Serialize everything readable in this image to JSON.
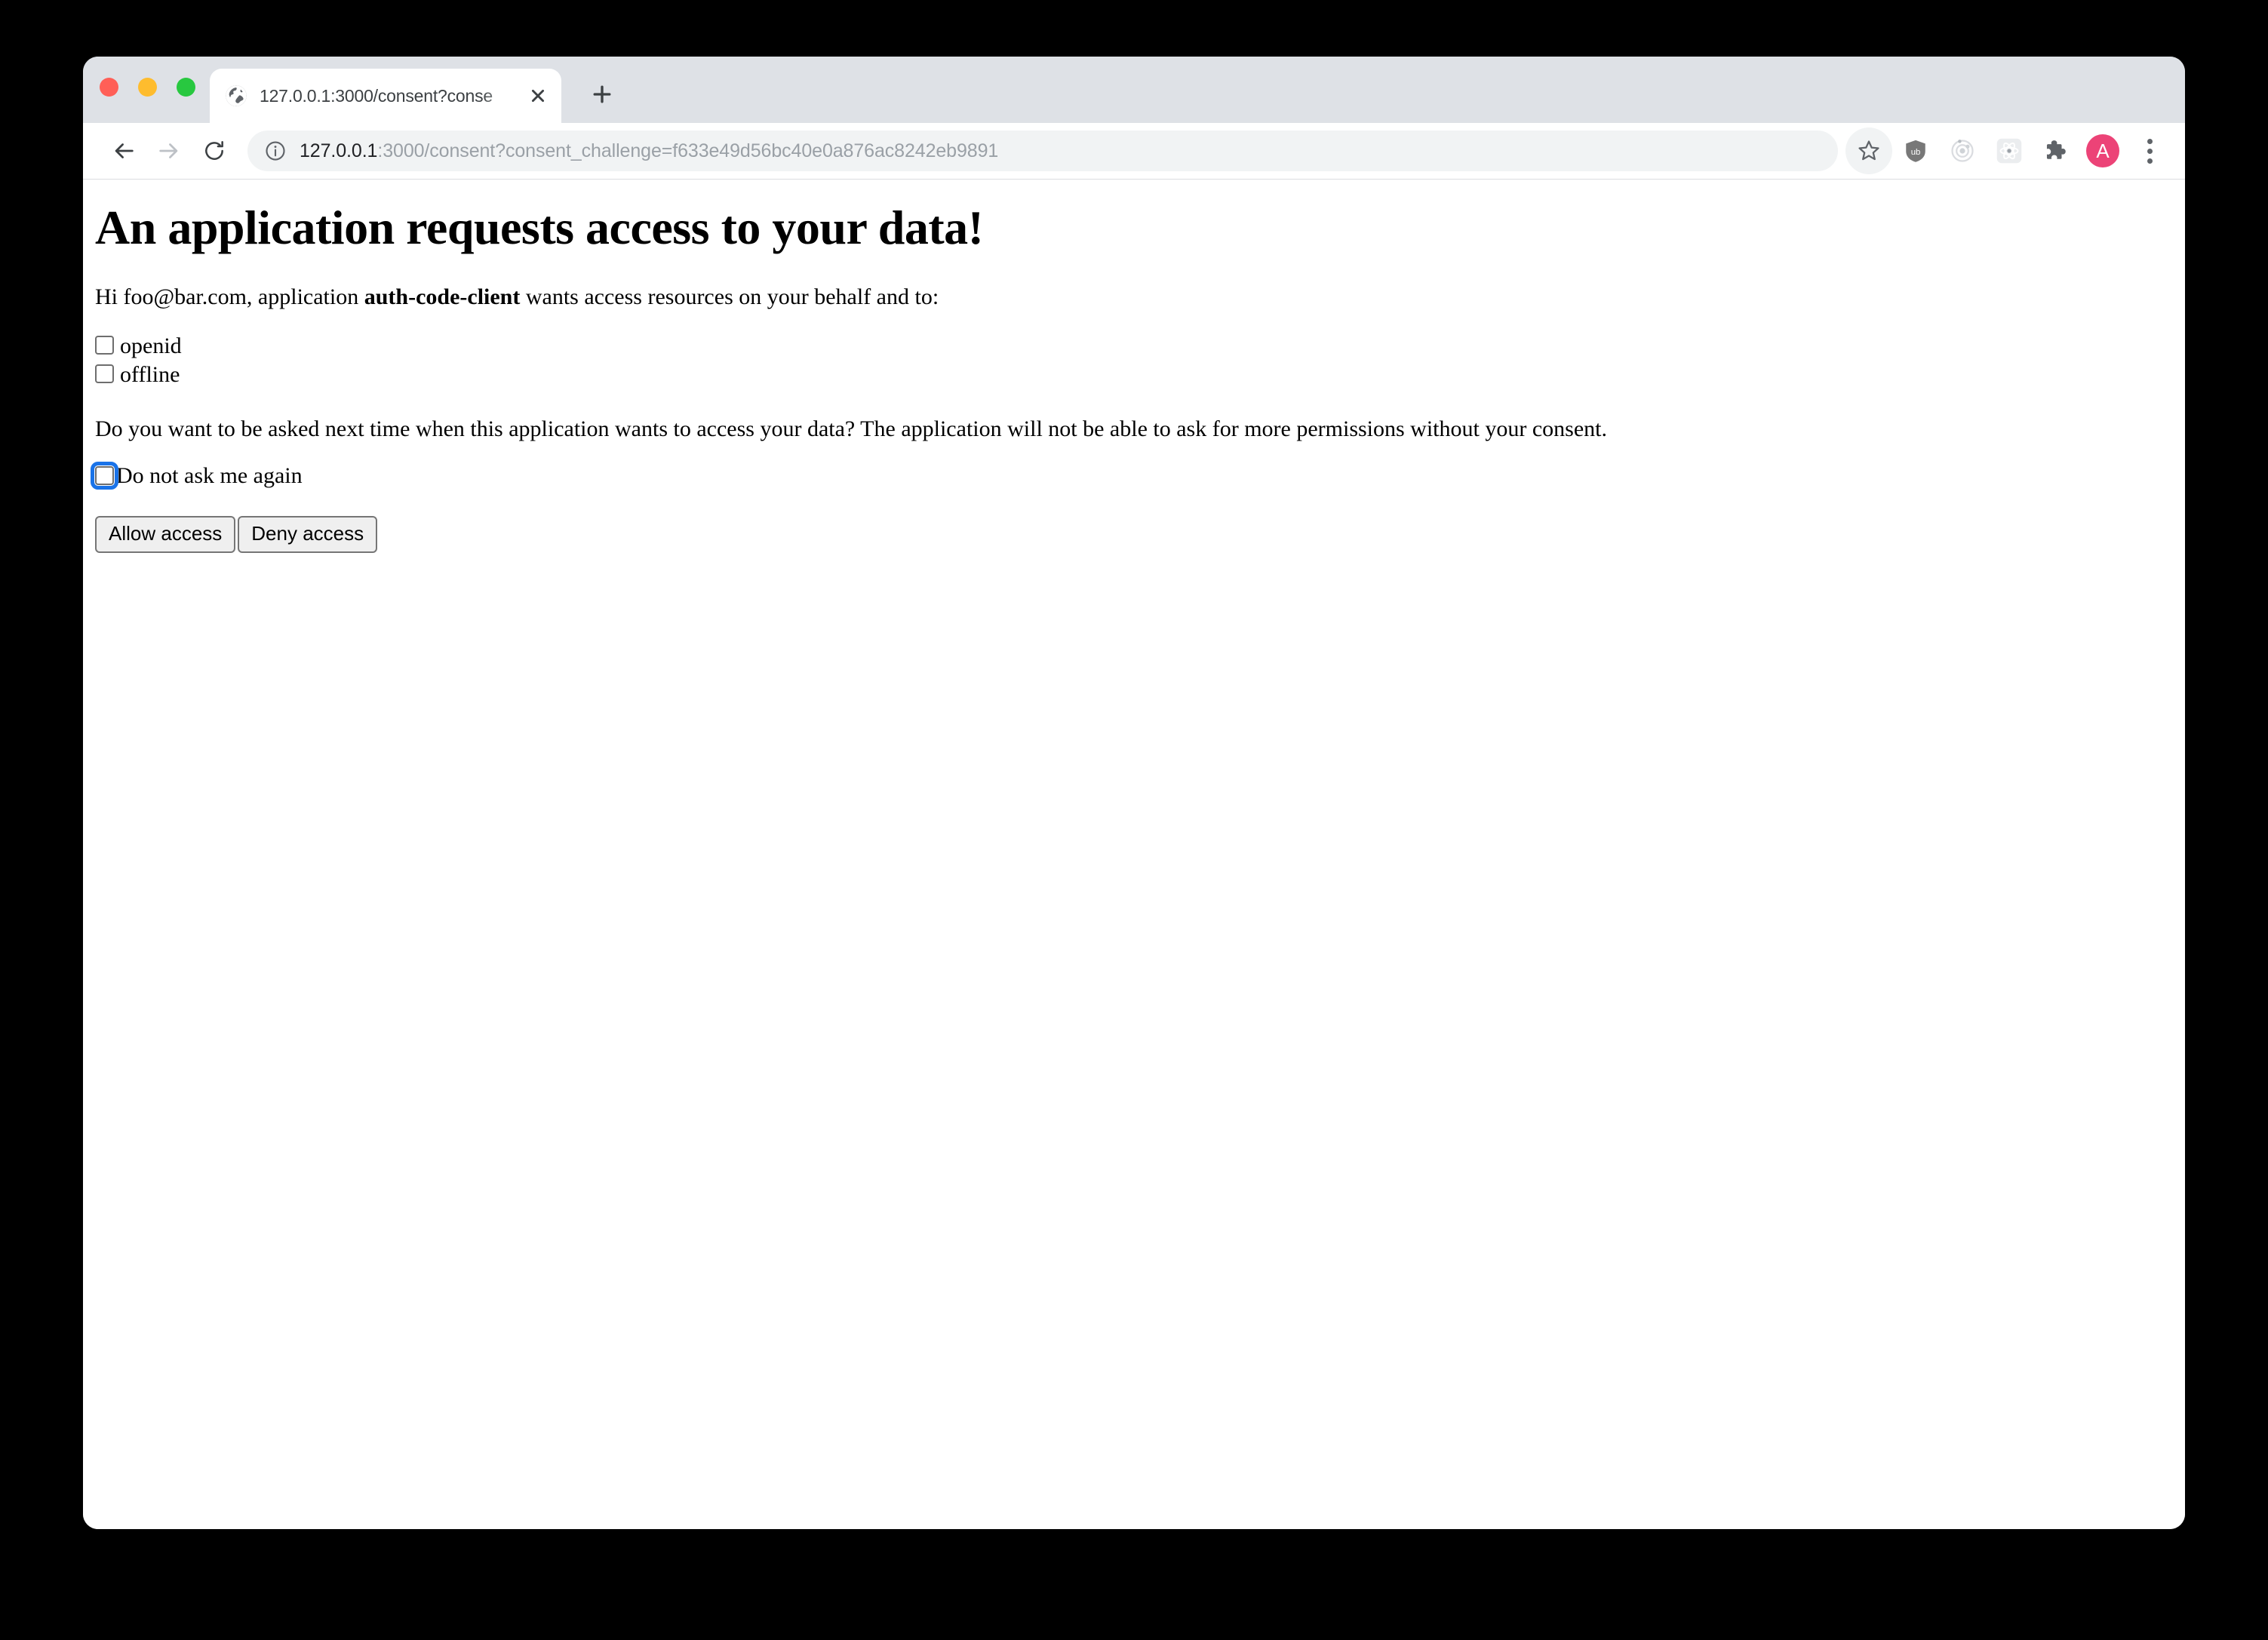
{
  "browser": {
    "traffic_lights": [
      "close",
      "minimize",
      "maximize"
    ],
    "tab": {
      "title": "127.0.0.1:3000/consent?conse",
      "favicon": "globe-icon",
      "close_label": "×"
    },
    "new_tab_label": "+",
    "nav": {
      "back": "back-arrow-icon",
      "forward": "forward-arrow-icon",
      "reload": "reload-icon"
    },
    "omnibox": {
      "info_icon": "info-circle-icon",
      "host": "127.0.0.1",
      "rest": ":3000/consent?consent_challenge=f633e49d56bc40e0a876ac8242eb9891",
      "full_url": "127.0.0.1:3000/consent?consent_challenge=f633e49d56bc40e0a876ac8242eb9891"
    },
    "actions": [
      {
        "name": "bookmark-star-icon",
        "label": "Bookmark this tab"
      },
      {
        "name": "ublock-origin-icon",
        "label": "uBlock Origin"
      },
      {
        "name": "orbit-icon",
        "label": "Extension"
      },
      {
        "name": "react-devtools-icon",
        "label": "React Developer Tools"
      },
      {
        "name": "extensions-puzzle-icon",
        "label": "Extensions"
      },
      {
        "name": "profile-avatar",
        "label": "A"
      },
      {
        "name": "chrome-menu-icon",
        "label": "Customize and control Google Chrome"
      }
    ],
    "avatar_initial": "A",
    "avatar_color": "#ec4377"
  },
  "consent": {
    "heading": "An application requests access to your data!",
    "greeting_prefix": "Hi foo@bar.com, application ",
    "client_name": "auth-code-client",
    "greeting_suffix": " wants access resources on your behalf and to:",
    "scopes": [
      {
        "label": "openid",
        "checked": false
      },
      {
        "label": "offline",
        "checked": false
      }
    ],
    "remember_question": "Do you want to be asked next time when this application wants to access your data? The application will not be able to ask for more permissions without your consent.",
    "remember_checkbox": {
      "label": "Do not ask me again",
      "checked": false,
      "focused": true
    },
    "buttons": {
      "allow": "Allow access",
      "deny": "Deny access"
    }
  }
}
